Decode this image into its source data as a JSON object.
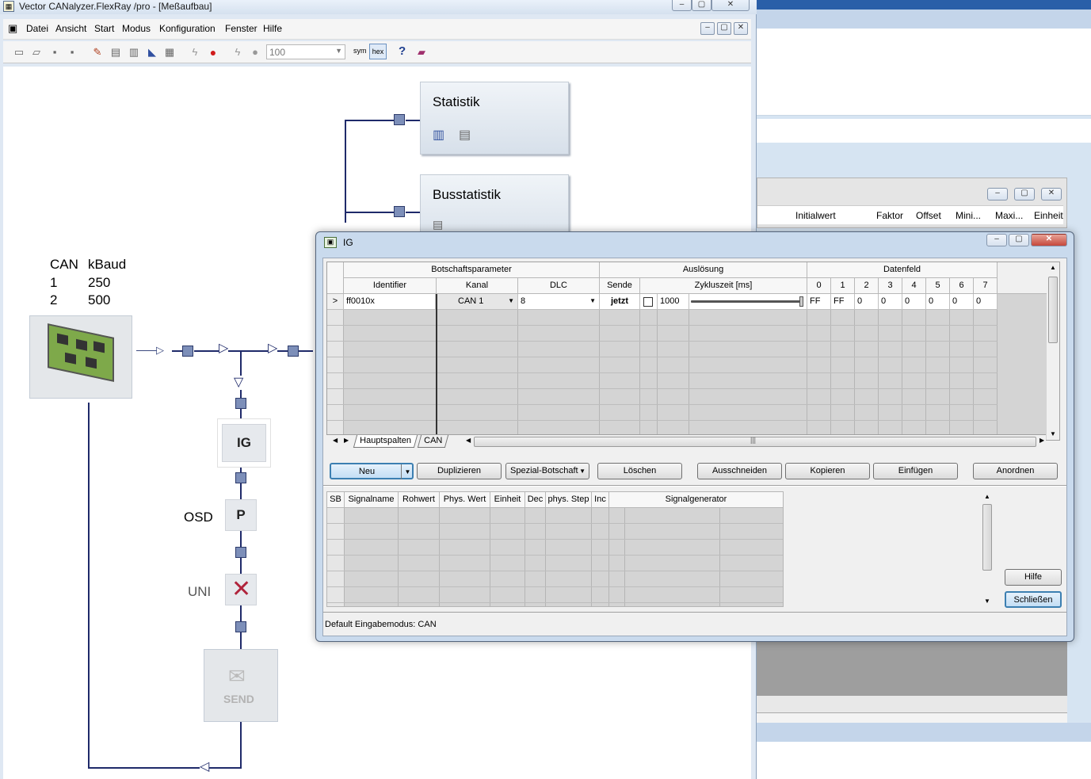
{
  "main_window": {
    "title": "Vector CANalyzer.FlexRay /pro  - [Meßaufbau]",
    "menu": [
      "Datei",
      "Ansicht",
      "Start",
      "Modus",
      "Konfiguration",
      "Fenster",
      "Hilfe"
    ],
    "toolbar": {
      "zoom_value": "100",
      "sym_label": "sym",
      "hex_label": "hex",
      "help_label": "?"
    }
  },
  "canvas": {
    "statistik_title": "Statistik",
    "busstatistik_title": "Busstatistik",
    "can_table": {
      "headers": [
        "CAN",
        "kBaud"
      ],
      "rows": [
        [
          "1",
          "250"
        ],
        [
          "2",
          "500"
        ]
      ]
    },
    "ig_block": "IG",
    "osd_label": "OSD",
    "p_block": "P",
    "uni_label": "UNI",
    "send_label": "SEND"
  },
  "background_window": {
    "columns": [
      "Initialwert",
      "Faktor",
      "Offset",
      "Mini...",
      "Maxi...",
      "Einheit"
    ]
  },
  "ig_dialog": {
    "title": "IG",
    "group_headers": [
      "Botschaftsparameter",
      "Auslösung",
      "Datenfeld"
    ],
    "column_headers": {
      "identifier": "Identifier",
      "kanal": "Kanal",
      "dlc": "DLC",
      "sende": "Sende",
      "zykluszeit": "Zykluszeit [ms]",
      "bytes": [
        "0",
        "1",
        "2",
        "3",
        "4",
        "5",
        "6",
        "7"
      ]
    },
    "row": {
      "marker": ">",
      "identifier": "ff0010x",
      "kanal": "CAN 1",
      "dlc": "8",
      "sende": "jetzt",
      "zykluszeit": "1000",
      "bytes": [
        "FF",
        "FF",
        "0",
        "0",
        "0",
        "0",
        "0",
        "0"
      ]
    },
    "tabs": [
      "Hauptspalten",
      "CAN"
    ],
    "buttons": {
      "neu": "Neu",
      "duplizieren": "Duplizieren",
      "spezial": "Spezial-Botschaft",
      "loeschen": "Löschen",
      "ausschneiden": "Ausschneiden",
      "kopieren": "Kopieren",
      "einfuegen": "Einfügen",
      "anordnen": "Anordnen",
      "hilfe": "Hilfe",
      "schliessen": "Schließen"
    },
    "signal_headers": [
      "SB",
      "Signalname",
      "Rohwert",
      "Phys. Wert",
      "Einheit",
      "Dec",
      "phys. Step",
      "Inc",
      "Signalgenerator"
    ],
    "status": "Default Eingabemodus: CAN"
  },
  "colors": {
    "connection_line": "#1f2a6a",
    "port_square": "#7d8fb9",
    "uni_cross": "#b0243c"
  }
}
